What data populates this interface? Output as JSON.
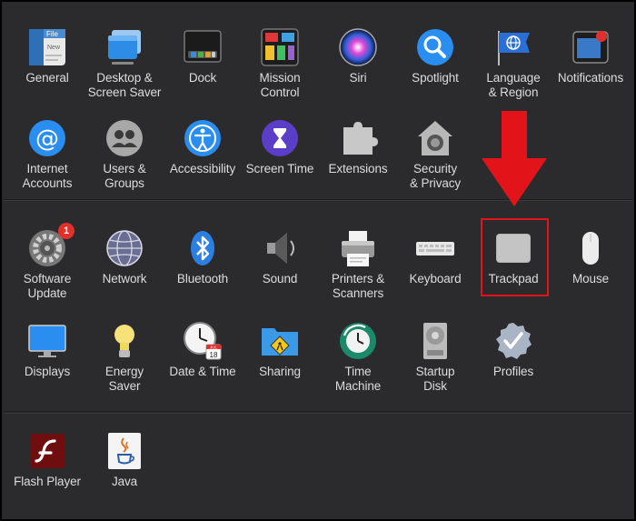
{
  "items": [
    {
      "id": "general",
      "label": "General",
      "icon": "general-icon"
    },
    {
      "id": "desktop",
      "label": "Desktop &\nScreen Saver",
      "icon": "desktop-icon"
    },
    {
      "id": "dock",
      "label": "Dock",
      "icon": "dock-icon"
    },
    {
      "id": "mission",
      "label": "Mission\nControl",
      "icon": "mission-control-icon"
    },
    {
      "id": "siri",
      "label": "Siri",
      "icon": "siri-icon"
    },
    {
      "id": "spotlight",
      "label": "Spotlight",
      "icon": "spotlight-icon"
    },
    {
      "id": "language",
      "label": "Language\n& Region",
      "icon": "language-flag-icon"
    },
    {
      "id": "notifications",
      "label": "Notifications",
      "icon": "notifications-icon"
    },
    {
      "id": "internet",
      "label": "Internet\nAccounts",
      "icon": "at-sign-icon"
    },
    {
      "id": "users",
      "label": "Users &\nGroups",
      "icon": "users-icon"
    },
    {
      "id": "accessibility",
      "label": "Accessibility",
      "icon": "accessibility-icon"
    },
    {
      "id": "screentime",
      "label": "Screen Time",
      "icon": "hourglass-icon"
    },
    {
      "id": "extensions",
      "label": "Extensions",
      "icon": "puzzle-icon"
    },
    {
      "id": "security",
      "label": "Security\n& Privacy",
      "icon": "house-lock-icon"
    },
    {
      "id": "software",
      "label": "Software\nUpdate",
      "icon": "gear-icon",
      "badge": "1"
    },
    {
      "id": "network",
      "label": "Network",
      "icon": "globe-icon"
    },
    {
      "id": "bluetooth",
      "label": "Bluetooth",
      "icon": "bluetooth-icon"
    },
    {
      "id": "sound",
      "label": "Sound",
      "icon": "speaker-icon"
    },
    {
      "id": "printers",
      "label": "Printers &\nScanners",
      "icon": "printer-icon"
    },
    {
      "id": "keyboard",
      "label": "Keyboard",
      "icon": "keyboard-icon"
    },
    {
      "id": "trackpad",
      "label": "Trackpad",
      "icon": "trackpad-icon"
    },
    {
      "id": "mouse",
      "label": "Mouse",
      "icon": "mouse-icon"
    },
    {
      "id": "displays",
      "label": "Displays",
      "icon": "display-icon"
    },
    {
      "id": "energy",
      "label": "Energy\nSaver",
      "icon": "lightbulb-icon"
    },
    {
      "id": "datetime",
      "label": "Date & Time",
      "icon": "clock-calendar-icon"
    },
    {
      "id": "sharing",
      "label": "Sharing",
      "icon": "sharing-folder-icon"
    },
    {
      "id": "timemachine",
      "label": "Time\nMachine",
      "icon": "time-machine-icon"
    },
    {
      "id": "startup",
      "label": "Startup\nDisk",
      "icon": "disk-icon"
    },
    {
      "id": "profiles",
      "label": "Profiles",
      "icon": "profiles-badge-icon"
    },
    {
      "id": "flash",
      "label": "Flash Player",
      "icon": "flash-icon"
    },
    {
      "id": "java",
      "label": "Java",
      "icon": "java-icon"
    }
  ],
  "icon_texts": {
    "general_file": "File",
    "general_new": "New",
    "calendar_month": "JUL",
    "calendar_day": "18"
  },
  "colors": {
    "accent_red": "#e2141a",
    "badge_red": "#e0302c",
    "label": "#dcdcdc"
  }
}
